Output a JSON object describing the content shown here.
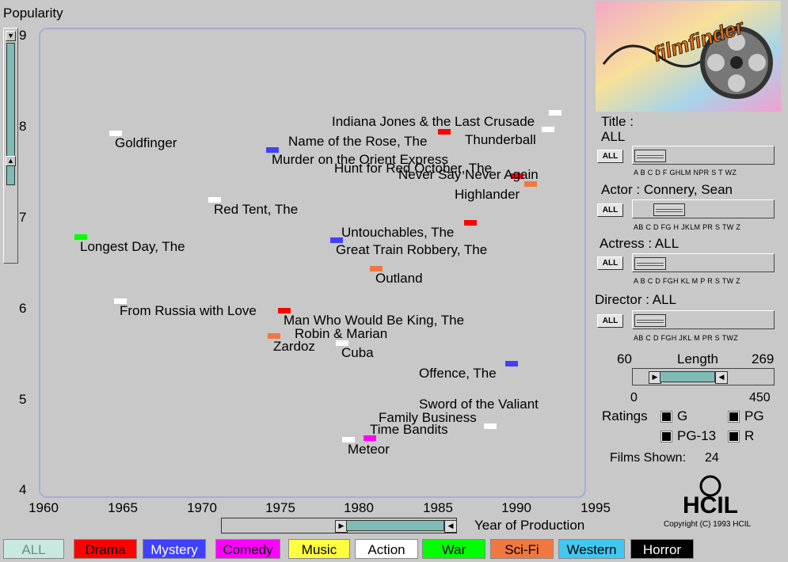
{
  "axes": {
    "y_title": "Popularity",
    "x_title": "Year of Production",
    "y_ticks": [
      "9",
      "8",
      "7",
      "6",
      "5",
      "4"
    ],
    "x_ticks": [
      "1960",
      "1965",
      "1970",
      "1975",
      "1980",
      "1985",
      "1990",
      "1995"
    ]
  },
  "films": [
    {
      "title": "Indiana Jones & the Last Crusade",
      "color": "#ff0000",
      "year": 1986,
      "pop": 7.9
    },
    {
      "title": "Goldfinger",
      "color": "#ffffff",
      "year": 1964.6,
      "pop": 7.9
    },
    {
      "title": "Name of the Rose, The",
      "color": "#4040ff",
      "year": 1974.7,
      "pop": 7.7
    },
    {
      "title": "Thunderball",
      "color": "#ffffff",
      "year": 1992.6,
      "pop": 8.1
    },
    {
      "title": "Murder on the Orient Express",
      "color": "#4040ff",
      "year": 1974.7,
      "pop": 7.7
    },
    {
      "title": "Hunt for Red October, The",
      "color": "#ff0000",
      "year": 1990.4,
      "pop": 7.4
    },
    {
      "title": "Never Say Never Again",
      "color": "#ffffff",
      "year": 1992.4,
      "pop": 7.9
    },
    {
      "title": "Highlander",
      "color": "#f07840",
      "year": 1991.2,
      "pop": 7.3
    },
    {
      "title": "Red Tent, The",
      "color": "#ffffff",
      "year": 1971.1,
      "pop": 7.2
    },
    {
      "title": "Untouchables, The",
      "color": "#ff0000",
      "year": 1987.4,
      "pop": 6.9
    },
    {
      "title": "Longest Day, The",
      "color": "#00ff00",
      "year": 1962.3,
      "pop": 6.8
    },
    {
      "title": "Great Train Robbery, The",
      "color": "#4040ff",
      "year": 1978.7,
      "pop": 6.7
    },
    {
      "title": "Outland",
      "color": "#f07840",
      "year": 1981.3,
      "pop": 6.4
    },
    {
      "title": "From Russia with Love",
      "color": "#ffffff",
      "year": 1964.8,
      "pop": 6.1
    },
    {
      "title": "Man Who Would Be King, The",
      "color": "#ff0000",
      "year": 1975.6,
      "pop": 6.0
    },
    {
      "title": "Robin & Marian",
      "color": "#f07840",
      "year": 1974.8,
      "pop": 5.7
    },
    {
      "title": "Zardoz",
      "color": "#f07840",
      "year": 1974.8,
      "pop": 5.7
    },
    {
      "title": "Cuba",
      "color": "#ffffff",
      "year": 1979.3,
      "pop": 5.6
    },
    {
      "title": "Offence, The",
      "color": "#4040ff",
      "year": 1990.2,
      "pop": 5.4
    },
    {
      "title": "Sword of the Valiant",
      "color": "#ffffff",
      "year": 1988.7,
      "pop": 4.7
    },
    {
      "title": "Family Business",
      "color": "#ffffff",
      "year": 1988.7,
      "pop": 4.7
    },
    {
      "title": "Time Bandits",
      "color": "#ff00ff",
      "year": 1981.1,
      "pop": 4.55
    },
    {
      "title": "Meteor",
      "color": "#ffffff",
      "year": 1979.6,
      "pop": 4.55
    }
  ],
  "panel": {
    "title_label": "Title :",
    "title_value": "ALL",
    "actor_label": "Actor : Connery, Sean",
    "actress_label": "Actress : ALL",
    "director_label": "Director : ALL",
    "all_button": "ALL",
    "title_alpha": "A B C D F GHLM NPR S  T  WZ",
    "actor_alpha": "AB  C  D FG H JKLM  PR S  TW Z",
    "actress_alpha": "A B  C  D FGH KL M  P R S  TW Z",
    "director_alpha": "AB  C  D FGH JKL M  PR S  TWZ",
    "length_label": "Length",
    "length_min": "60",
    "length_max": "269",
    "length_scale_min": "0",
    "length_scale_max": "450",
    "ratings_label": "Ratings",
    "rating_g": "G",
    "rating_pg": "PG",
    "rating_pg13": "PG-13",
    "rating_r": "R",
    "films_shown_label": "Films Shown:",
    "films_shown_value": "24",
    "logo_text": "filmfinder",
    "hcil_logo": "HCIL",
    "copyright": "Copyright (C) 1993 HCIL"
  },
  "genres": [
    {
      "label": "ALL",
      "bg": "#c8e8e0",
      "fg": "#6c8c88"
    },
    {
      "label": "Drama",
      "bg": "#ff0000",
      "fg": "#000000"
    },
    {
      "label": "Mystery",
      "bg": "#4040ff",
      "fg": "#ffffff"
    },
    {
      "label": "Comedy",
      "bg": "#ff00ff",
      "fg": "#000000"
    },
    {
      "label": "Music",
      "bg": "#ffff40",
      "fg": "#000000"
    },
    {
      "label": "Action",
      "bg": "#ffffff",
      "fg": "#000000"
    },
    {
      "label": "War",
      "bg": "#00ff00",
      "fg": "#000000"
    },
    {
      "label": "Sci-Fi",
      "bg": "#f07840",
      "fg": "#000000"
    },
    {
      "label": "Western",
      "bg": "#40c8f0",
      "fg": "#000000"
    },
    {
      "label": "Horror",
      "bg": "#000000",
      "fg": "#ffffff"
    }
  ]
}
